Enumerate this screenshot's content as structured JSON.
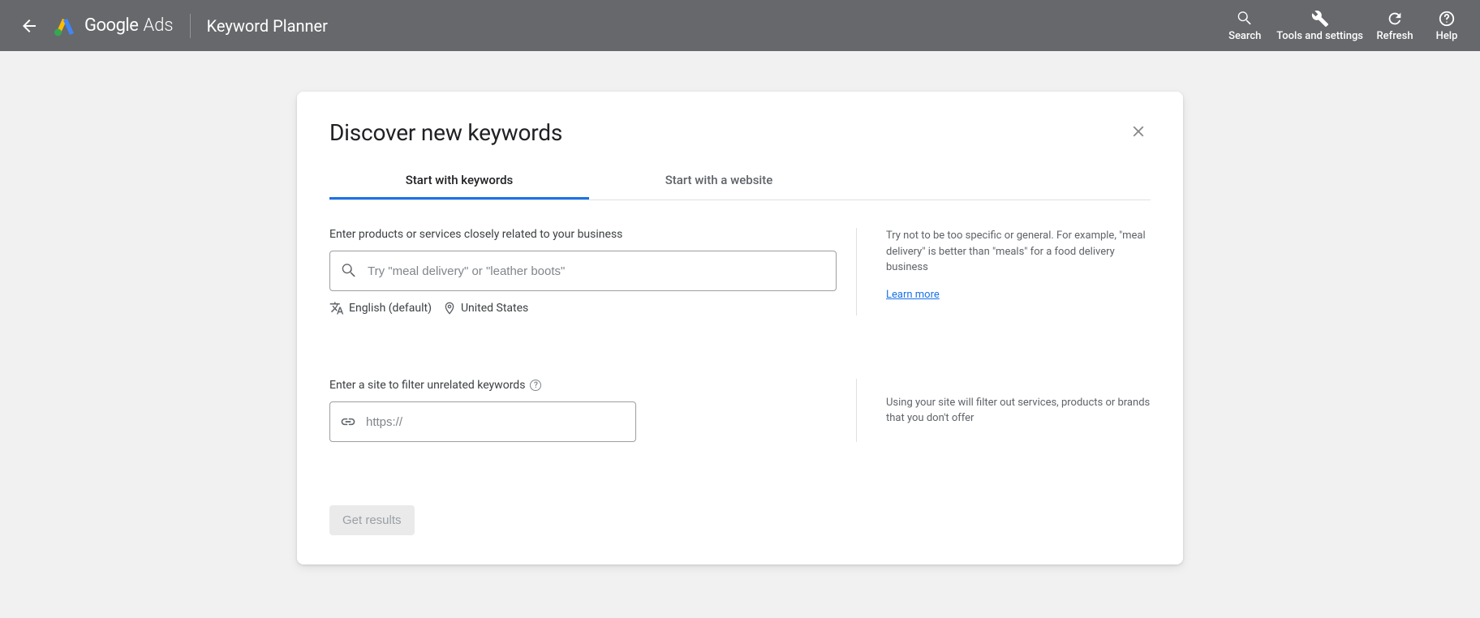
{
  "header": {
    "brand_google": "Google",
    "brand_ads": "Ads",
    "page_title": "Keyword Planner",
    "actions": {
      "search": "Search",
      "tools": "Tools and settings",
      "refresh": "Refresh",
      "help": "Help"
    }
  },
  "card": {
    "title": "Discover new keywords",
    "tabs": {
      "keywords": "Start with keywords",
      "website": "Start with a website"
    },
    "section1": {
      "label": "Enter products or services closely related to your business",
      "placeholder": "Try \"meal delivery\" or \"leather boots\"",
      "language": "English (default)",
      "location": "United States",
      "tip": "Try not to be too specific or general. For example, \"meal delivery\" is better than \"meals\" for a food delivery business",
      "learn_more": "Learn more"
    },
    "section2": {
      "label": "Enter a site to filter unrelated keywords",
      "placeholder": "https://",
      "tip": "Using your site will filter out services, products or brands that you don't offer"
    },
    "submit": "Get results"
  }
}
